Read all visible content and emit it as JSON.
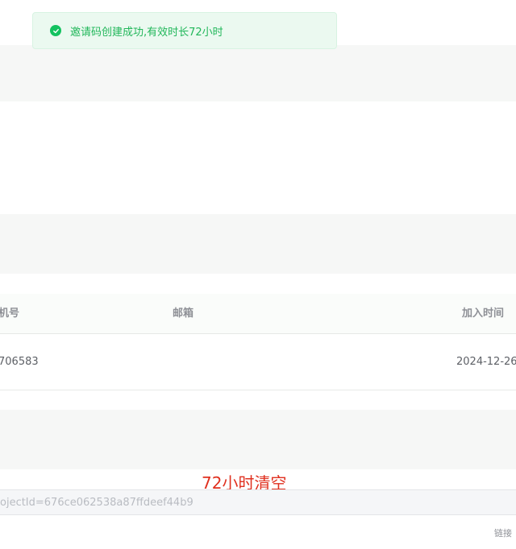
{
  "toast": {
    "message": "邀请码创建成功,有效时长72小时",
    "icon": "check-circle-icon",
    "color": "#21b75a"
  },
  "table": {
    "headers": {
      "phone": "机号",
      "email": "邮箱",
      "join_time": "加入时间"
    },
    "rows": [
      {
        "phone": "706583",
        "email": "",
        "join_time": "2024-12-26"
      }
    ]
  },
  "annotation": {
    "text": "72小时清空",
    "color": "#e0301f"
  },
  "invite_link": {
    "value": "ojectId=676ce062538a87ffdeef44b9"
  },
  "link_label": "链接"
}
